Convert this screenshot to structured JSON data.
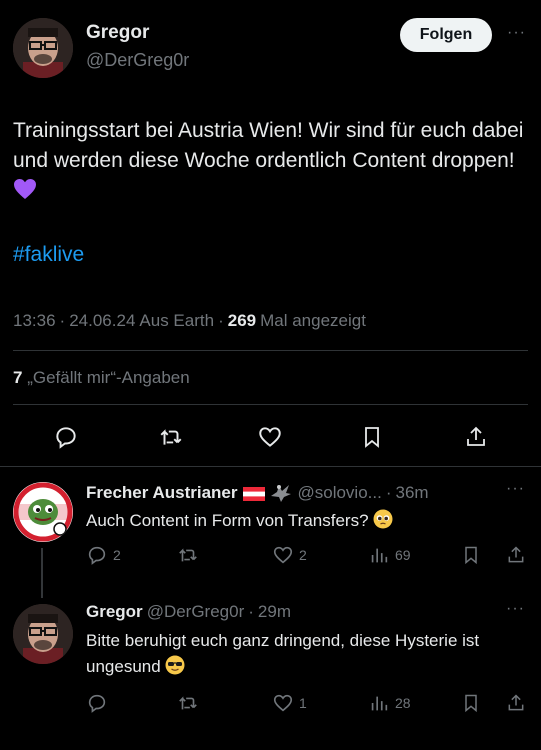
{
  "tweet": {
    "author_name": "Gregor",
    "author_handle": "@DerGreg0r",
    "follow_label": "Folgen",
    "more": "···",
    "text": "Trainingsstart bei Austria Wien! Wir sind für euch dabei und werden diese Woche ordentlich Content droppen!",
    "hashtag": "#faklive",
    "time": "13:36",
    "date": "24.06.24",
    "source": "Aus Earth",
    "views_count": "269",
    "views_label": "Mal angezeigt",
    "likes_count": "7",
    "likes_label": "„Gefällt mir“-Angaben",
    "icons": [
      "reply-icon",
      "retweet-icon",
      "like-icon",
      "bookmark-icon",
      "share-icon"
    ]
  },
  "replies": [
    {
      "name": "Frecher Austrianer",
      "handle": "@solovio...",
      "time": "36m",
      "text": "Auch Content in Form von Transfers?",
      "reply_count": "2",
      "retweet_count": "",
      "like_count": "2",
      "view_count": "69"
    },
    {
      "name": "Gregor",
      "handle": "@DerGreg0r",
      "time": "29m",
      "text": "Bitte beruhigt euch ganz dringend, diese Hysterie ist ungesund",
      "reply_count": "",
      "retweet_count": "",
      "like_count": "1",
      "view_count": "28"
    }
  ],
  "colors": {
    "background": "#000000",
    "text": "#e7e9ea",
    "muted": "#71767b",
    "link": "#1d9bf0",
    "heart": "#a259f7"
  }
}
